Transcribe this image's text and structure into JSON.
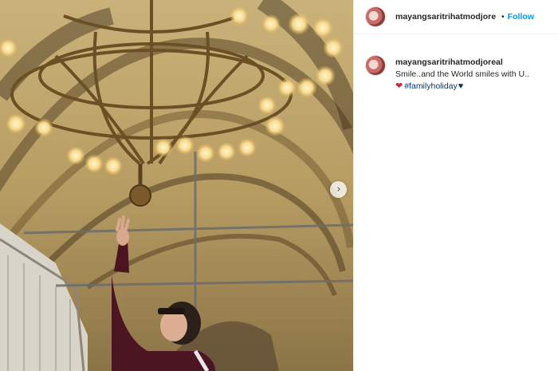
{
  "post": {
    "username": "mayangsaritrihatmodjoreal",
    "header_username": "mayangsaritrihatmodjore",
    "separator": "•",
    "follow_label": "Follow",
    "more_icon": "more-horizontal-icon",
    "caption_text": "Smile..and the World smiles with U..",
    "hashtag": "#familyholiday",
    "emoji_before": "❤",
    "emoji_after": "♥"
  },
  "media": {
    "description_icon": "photo",
    "next_icon": "chevron-right-icon",
    "next_glyph": "›"
  },
  "colors": {
    "link_blue": "#0095f6",
    "hashtag_blue": "#00376b",
    "heart_red": "#d0253a"
  }
}
